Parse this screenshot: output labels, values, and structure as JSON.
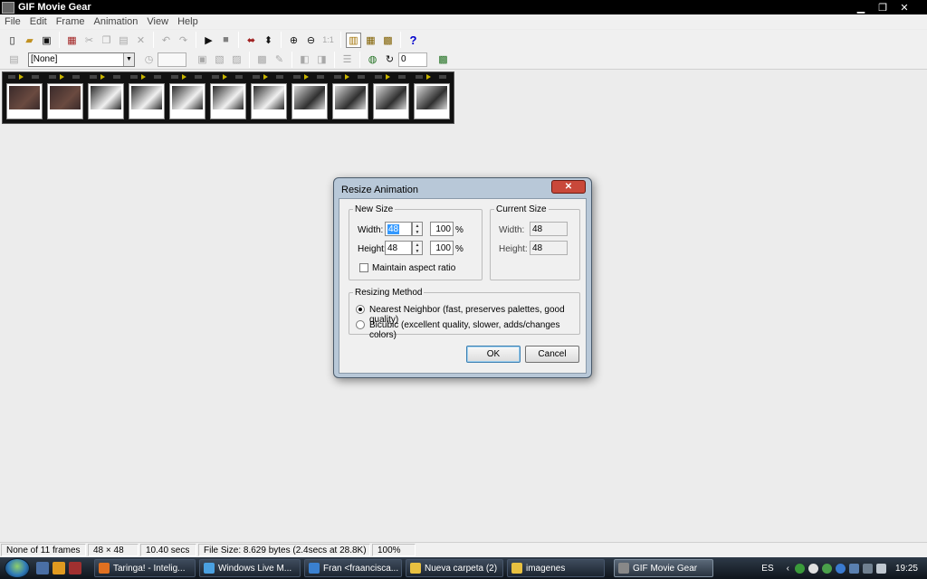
{
  "window": {
    "title": "GIF Movie Gear",
    "controls": {
      "minimize": "▁",
      "maximize": "❐",
      "close": "✕"
    }
  },
  "menu": [
    "File",
    "Edit",
    "Frame",
    "Animation",
    "View",
    "Help"
  ],
  "toolbar1": {
    "help_label": "?",
    "zoom_reset_label": "1:1"
  },
  "toolbar2": {
    "palette_combo_value": "[None]",
    "loop_value": "0"
  },
  "filmstrip": {
    "frame_count": 11
  },
  "dialog": {
    "title": "Resize Animation",
    "close_label": "✕",
    "new_size": {
      "legend": "New Size",
      "width_label": "Width:",
      "width_value": "48",
      "width_percent": "100",
      "height_label": "Height:",
      "height_value": "48",
      "height_percent": "100",
      "percent_sign": "%",
      "maintain_label": "Maintain aspect ratio",
      "maintain_checked": false
    },
    "current_size": {
      "legend": "Current Size",
      "width_label": "Width:",
      "width_value": "48",
      "height_label": "Height:",
      "height_value": "48"
    },
    "resizing_method": {
      "legend": "Resizing Method",
      "options": [
        {
          "label": "Nearest Neighbor (fast, preserves palettes, good quality)",
          "selected": true
        },
        {
          "label": "Bicubic (excellent quality, slower, adds/changes colors)",
          "selected": false
        }
      ]
    },
    "ok_label": "OK",
    "cancel_label": "Cancel"
  },
  "statusbar": {
    "frames": "None of 11 frames",
    "dimensions": "48 × 48",
    "duration": "10.40 secs",
    "filesize": "File Size: 8.629 bytes  (2.4secs at 28.8K)",
    "zoom": "100%"
  },
  "taskbar": {
    "tasks": [
      {
        "label": "Taringa! - Intelig...",
        "color": "#e07020"
      },
      {
        "label": "Windows Live M...",
        "color": "#4aa0e0"
      },
      {
        "label": "Fran <fraancisca...",
        "color": "#3a80d0"
      },
      {
        "label": "Nueva carpeta (2)",
        "color": "#e8c040"
      },
      {
        "label": "imagenes",
        "color": "#e8c040"
      },
      {
        "label": "GIF Movie Gear",
        "color": "#888888",
        "active": true
      }
    ],
    "language": "ES",
    "clock": "19:25"
  }
}
